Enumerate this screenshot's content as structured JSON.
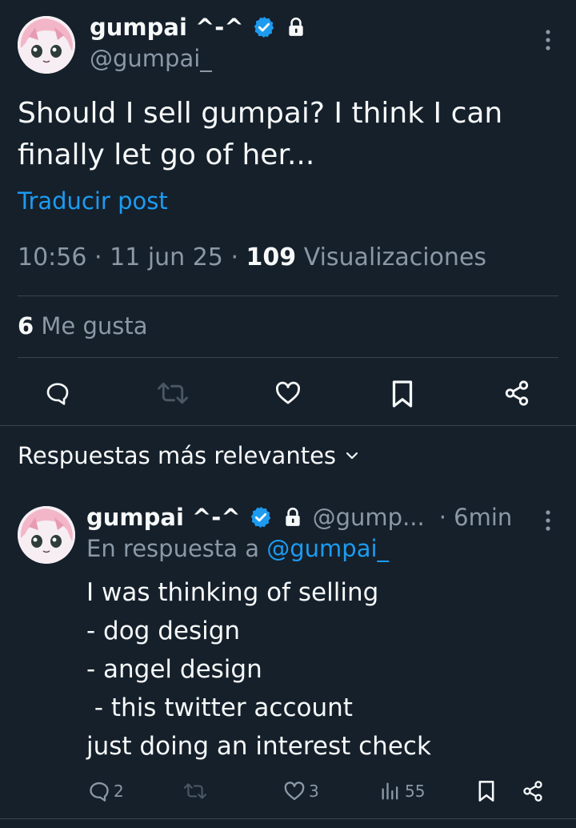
{
  "post": {
    "display_name": "gumpai ^-^",
    "handle": "@gumpai_",
    "text": "Should I sell gumpai? I think I can\nfinally let go of her...",
    "translate_label": "Traducir post",
    "time": "10:56",
    "date": "11 jun 25",
    "views_count": "109",
    "views_label": "Visualizaciones",
    "likes_count": "6",
    "likes_label": "Me gusta",
    "separator": "·"
  },
  "replies_section": {
    "title": "Respuestas más relevantes"
  },
  "reply": {
    "display_name": "gumpai ^-^",
    "handle": "@gump...",
    "time": "· 6min",
    "reply_to_label": "En respuesta a",
    "reply_to_handle": "@gumpai_",
    "text": "I was thinking of selling\n- dog design\n- angel design\n - this twitter account\njust doing an interest check",
    "replies_count": "2",
    "likes_count": "3",
    "views_count": "55"
  },
  "icons": {
    "verified": "verified-badge-icon",
    "lock": "lock-icon",
    "more": "more-vertical-icon",
    "reply": "reply-icon",
    "retweet": "retweet-icon",
    "like": "heart-icon",
    "bookmark": "bookmark-icon",
    "share": "share-icon",
    "views": "views-icon",
    "chevron": "chevron-down-icon"
  },
  "colors": {
    "background": "#15202b",
    "text": "#f7f9f9",
    "secondary": "#8b98a5",
    "accent": "#1d9bf0",
    "divider": "#38444d",
    "verified": "#1d9bf0"
  }
}
